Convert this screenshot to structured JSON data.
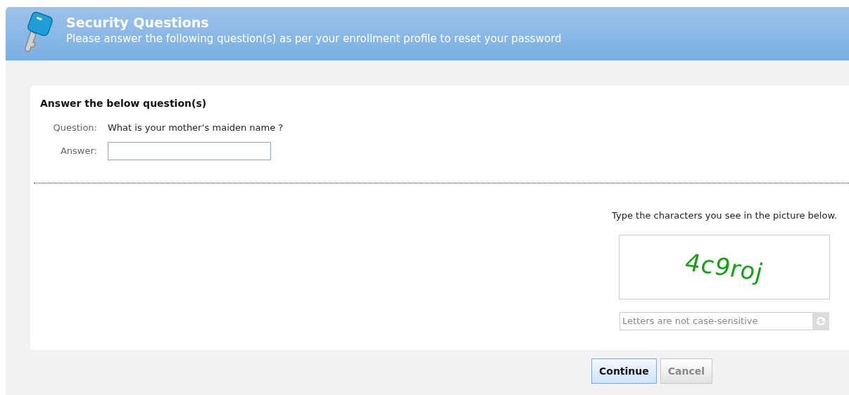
{
  "header": {
    "title": "Security Questions",
    "subtitle": "Please answer the following question(s) as per your enrollment profile to reset your password"
  },
  "form": {
    "heading": "Answer the below question(s)",
    "fields": [
      {
        "kind": "text",
        "label": "Question:",
        "value": "What is your mother’s maiden name ?"
      },
      {
        "kind": "input",
        "label": "Answer:"
      }
    ]
  },
  "captcha": {
    "instruction": "Type the characters you see in the picture below.",
    "text": "4c9roj",
    "placeholder": "Letters are not case-sensitive"
  },
  "buttons": [
    {
      "label": "Continue",
      "disabled": false
    },
    {
      "label": "Cancel",
      "disabled": true
    }
  ]
}
